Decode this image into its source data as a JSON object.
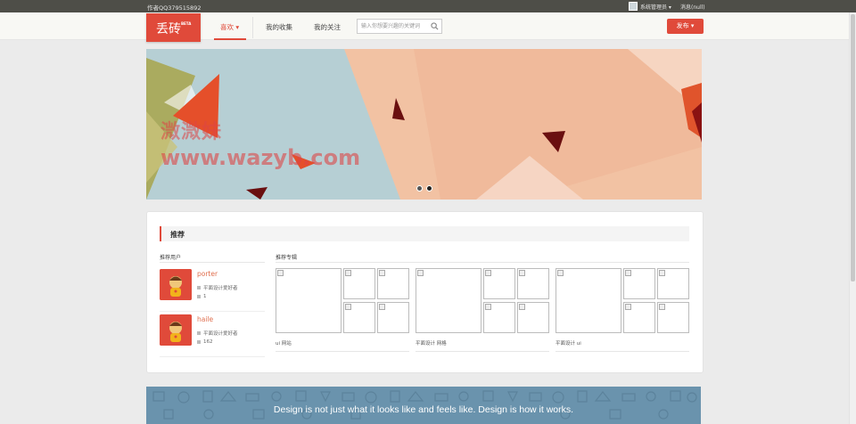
{
  "topbar": {
    "author": "作者QQ379515892",
    "user_name": "系统管理员 ▾",
    "messages": "消息(null)"
  },
  "nav": {
    "logo": "丢砖",
    "logo_badge": "BETA",
    "tabs": [
      "喜欢 ▾",
      "我的收集",
      "我的关注"
    ],
    "search_placeholder": "输入你想要兴趣的关键词",
    "publish": "发布 ▾"
  },
  "banner": {
    "watermark_cn": "溦溦妹",
    "watermark_url": "www.wazyb.com",
    "slides": 2,
    "active_slide": 2
  },
  "recommend": {
    "title": "推荐",
    "users_title": "推荐用户",
    "albums_title": "推荐专辑",
    "users": [
      {
        "name": "porter",
        "tag": "平面设计爱好者",
        "count": "1"
      },
      {
        "name": "haile",
        "tag": "平面设计爱好者",
        "count": "162"
      }
    ],
    "albums": [
      {
        "caption": "ui 网站"
      },
      {
        "caption": "平面设计 网格"
      },
      {
        "caption": "平面设计 ui"
      }
    ]
  },
  "footer": {
    "quote": "Design is not just what it looks like and feels like. Design is how it works."
  },
  "colors": {
    "accent": "#e04a3a",
    "topbar": "#4e4e48",
    "footer_banner": "#6a93ad"
  }
}
